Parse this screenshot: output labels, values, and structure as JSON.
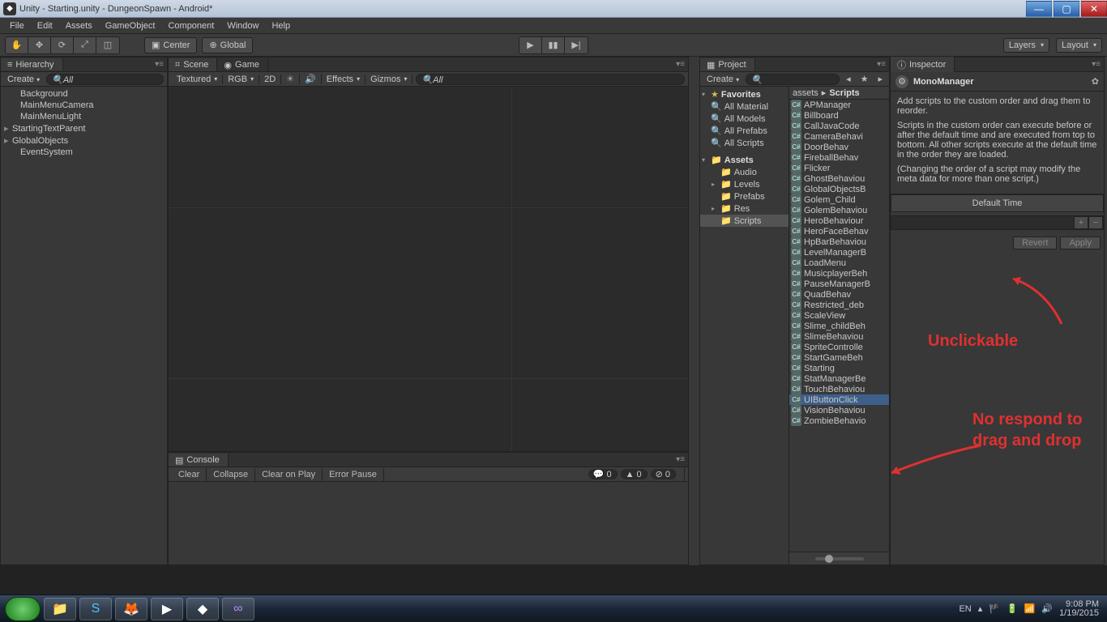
{
  "window_title": "Unity - Starting.unity - DungeonSpawn - Android*",
  "menubar": [
    "File",
    "Edit",
    "Assets",
    "GameObject",
    "Component",
    "Window",
    "Help"
  ],
  "toolbar": {
    "pivot_mode": "Center",
    "space_mode": "Global",
    "layers_label": "Layers",
    "layout_label": "Layout"
  },
  "hierarchy": {
    "tab": "Hierarchy",
    "create": "Create",
    "search_placeholder": "All",
    "items": [
      {
        "name": "Background",
        "expand": ""
      },
      {
        "name": "MainMenuCamera",
        "expand": ""
      },
      {
        "name": "MainMenuLight",
        "expand": ""
      },
      {
        "name": "StartingTextParent",
        "expand": "▸"
      },
      {
        "name": "GlobalObjects",
        "expand": "▸"
      },
      {
        "name": "EventSystem",
        "expand": ""
      }
    ]
  },
  "scene": {
    "tab_scene": "Scene",
    "tab_game": "Game",
    "shading": "Textured",
    "render": "RGB",
    "mode2d": "2D",
    "effects": "Effects",
    "gizmos": "Gizmos",
    "search_placeholder": "All"
  },
  "console": {
    "tab": "Console",
    "buttons": [
      "Clear",
      "Collapse",
      "Clear on Play",
      "Error Pause"
    ],
    "counts": {
      "info": "0",
      "warn": "0",
      "error": "0"
    }
  },
  "project": {
    "tab": "Project",
    "create": "Create",
    "favorites_label": "Favorites",
    "favorites": [
      "All Material",
      "All Models",
      "All Prefabs",
      "All Scripts"
    ],
    "assets_label": "Assets",
    "folders": [
      "Audio",
      "Levels",
      "Prefabs",
      "Res",
      "Scripts"
    ],
    "selected_folder": "Scripts",
    "crumb_root": "assets",
    "crumb_folder": "Scripts",
    "files": [
      "APManager",
      "Billboard",
      "CallJavaCode",
      "CameraBehavi",
      "DoorBehav",
      "FireballBehav",
      "Flicker",
      "GhostBehaviou",
      "GlobalObjectsB",
      "Golem_Child",
      "GolemBehaviou",
      "HeroBehaviour",
      "HeroFaceBehav",
      "HpBarBehaviou",
      "LevelManagerB",
      "LoadMenu",
      "MusicplayerBeh",
      "PauseManagerB",
      "QuadBehav",
      "Restricted_deb",
      "ScaleView",
      "Slime_childBeh",
      "SlimeBehaviou",
      "SpriteControlle",
      "StartGameBeh",
      "Starting",
      "StatManagerBe",
      "TouchBehaviou",
      "UIButtonClick",
      "VisionBehaviou",
      "ZombieBehavio"
    ],
    "selected_file": "UIButtonClick"
  },
  "inspector": {
    "tab": "Inspector",
    "title": "MonoManager",
    "desc1": "Add scripts to the custom order and drag them to reorder.",
    "desc2": "Scripts in the custom order can execute before or after the default time and are executed from top to bottom. All other scripts execute at the default time in the order they are loaded.",
    "desc3": "(Changing the order of a script may modify the meta data for more than one script.)",
    "default_time": "Default Time",
    "revert": "Revert",
    "apply": "Apply"
  },
  "annotations": {
    "a1": "Unclickable",
    "a2": "No respond to drag and drop"
  },
  "taskbar": {
    "lang": "EN",
    "time": "9:08 PM",
    "date": "1/19/2015"
  }
}
